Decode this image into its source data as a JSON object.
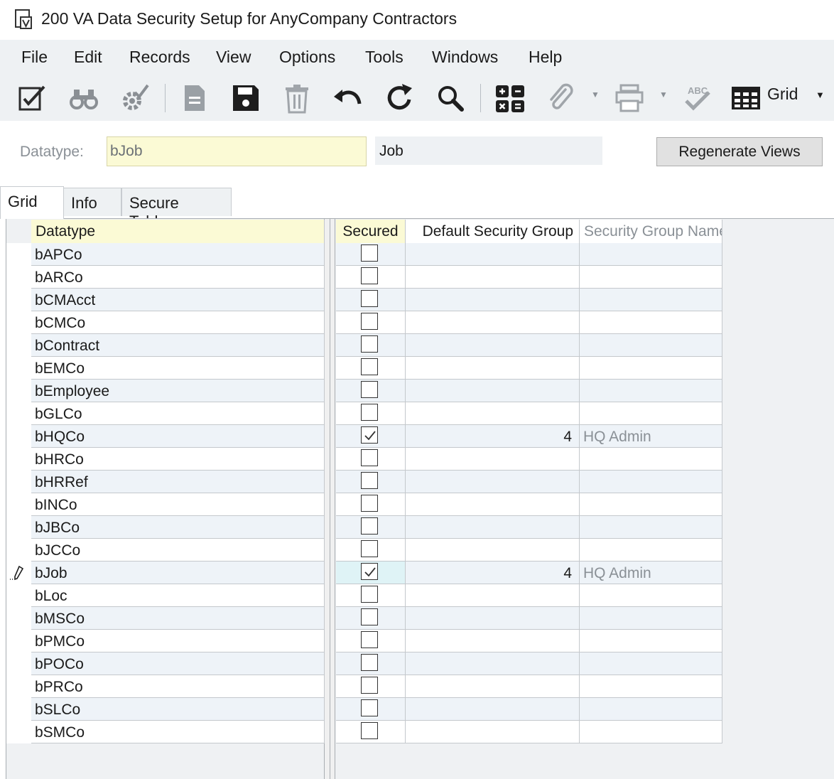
{
  "window": {
    "title": "200 VA Data Security Setup for AnyCompany Contractors"
  },
  "menu": [
    "File",
    "Edit",
    "Records",
    "View",
    "Options",
    "Tools",
    "Windows",
    "Help"
  ],
  "toolbar": {
    "icons": [
      "edit-check-icon",
      "binoculars-icon",
      "gear-check-icon",
      "new-document-icon",
      "save-icon",
      "delete-icon",
      "undo-icon",
      "refresh-icon",
      "search-icon",
      "calculator-icon",
      "attachment-icon",
      "print-icon",
      "spellcheck-icon",
      "grid-view-icon"
    ],
    "view_label": "Grid"
  },
  "header": {
    "datatype_label": "Datatype:",
    "datatype_value": "bJob",
    "datatype_description": "Job",
    "regenerate_button": "Regenerate Views"
  },
  "tabs": [
    "Grid",
    "Info",
    "Secure Tables"
  ],
  "grid": {
    "columns": [
      "Datatype",
      "Secured",
      "Default Security Group",
      "Security Group Name"
    ],
    "rows": [
      {
        "datatype": "bAPCo",
        "secured": false,
        "default_group": "",
        "group_name": ""
      },
      {
        "datatype": "bARCo",
        "secured": false,
        "default_group": "",
        "group_name": ""
      },
      {
        "datatype": "bCMAcct",
        "secured": false,
        "default_group": "",
        "group_name": ""
      },
      {
        "datatype": "bCMCo",
        "secured": false,
        "default_group": "",
        "group_name": ""
      },
      {
        "datatype": "bContract",
        "secured": false,
        "default_group": "",
        "group_name": ""
      },
      {
        "datatype": "bEMCo",
        "secured": false,
        "default_group": "",
        "group_name": ""
      },
      {
        "datatype": "bEmployee",
        "secured": false,
        "default_group": "",
        "group_name": ""
      },
      {
        "datatype": "bGLCo",
        "secured": false,
        "default_group": "",
        "group_name": ""
      },
      {
        "datatype": "bHQCo",
        "secured": true,
        "default_group": "4",
        "group_name": "HQ Admin"
      },
      {
        "datatype": "bHRCo",
        "secured": false,
        "default_group": "",
        "group_name": ""
      },
      {
        "datatype": "bHRRef",
        "secured": false,
        "default_group": "",
        "group_name": ""
      },
      {
        "datatype": "bINCo",
        "secured": false,
        "default_group": "",
        "group_name": ""
      },
      {
        "datatype": "bJBCo",
        "secured": false,
        "default_group": "",
        "group_name": ""
      },
      {
        "datatype": "bJCCo",
        "secured": false,
        "default_group": "",
        "group_name": ""
      },
      {
        "datatype": "bJob",
        "secured": true,
        "default_group": "4",
        "group_name": "HQ Admin",
        "current": true
      },
      {
        "datatype": "bLoc",
        "secured": false,
        "default_group": "",
        "group_name": ""
      },
      {
        "datatype": "bMSCo",
        "secured": false,
        "default_group": "",
        "group_name": ""
      },
      {
        "datatype": "bPMCo",
        "secured": false,
        "default_group": "",
        "group_name": ""
      },
      {
        "datatype": "bPOCo",
        "secured": false,
        "default_group": "",
        "group_name": ""
      },
      {
        "datatype": "bPRCo",
        "secured": false,
        "default_group": "",
        "group_name": ""
      },
      {
        "datatype": "bSLCo",
        "secured": false,
        "default_group": "",
        "group_name": ""
      },
      {
        "datatype": "bSMCo",
        "secured": false,
        "default_group": "",
        "group_name": ""
      }
    ]
  },
  "colors": {
    "row_alt": "#eef3f8",
    "row_plain": "#ffffff",
    "header_yellow": "#fbfad5",
    "current_cell": "#dff3f6"
  }
}
